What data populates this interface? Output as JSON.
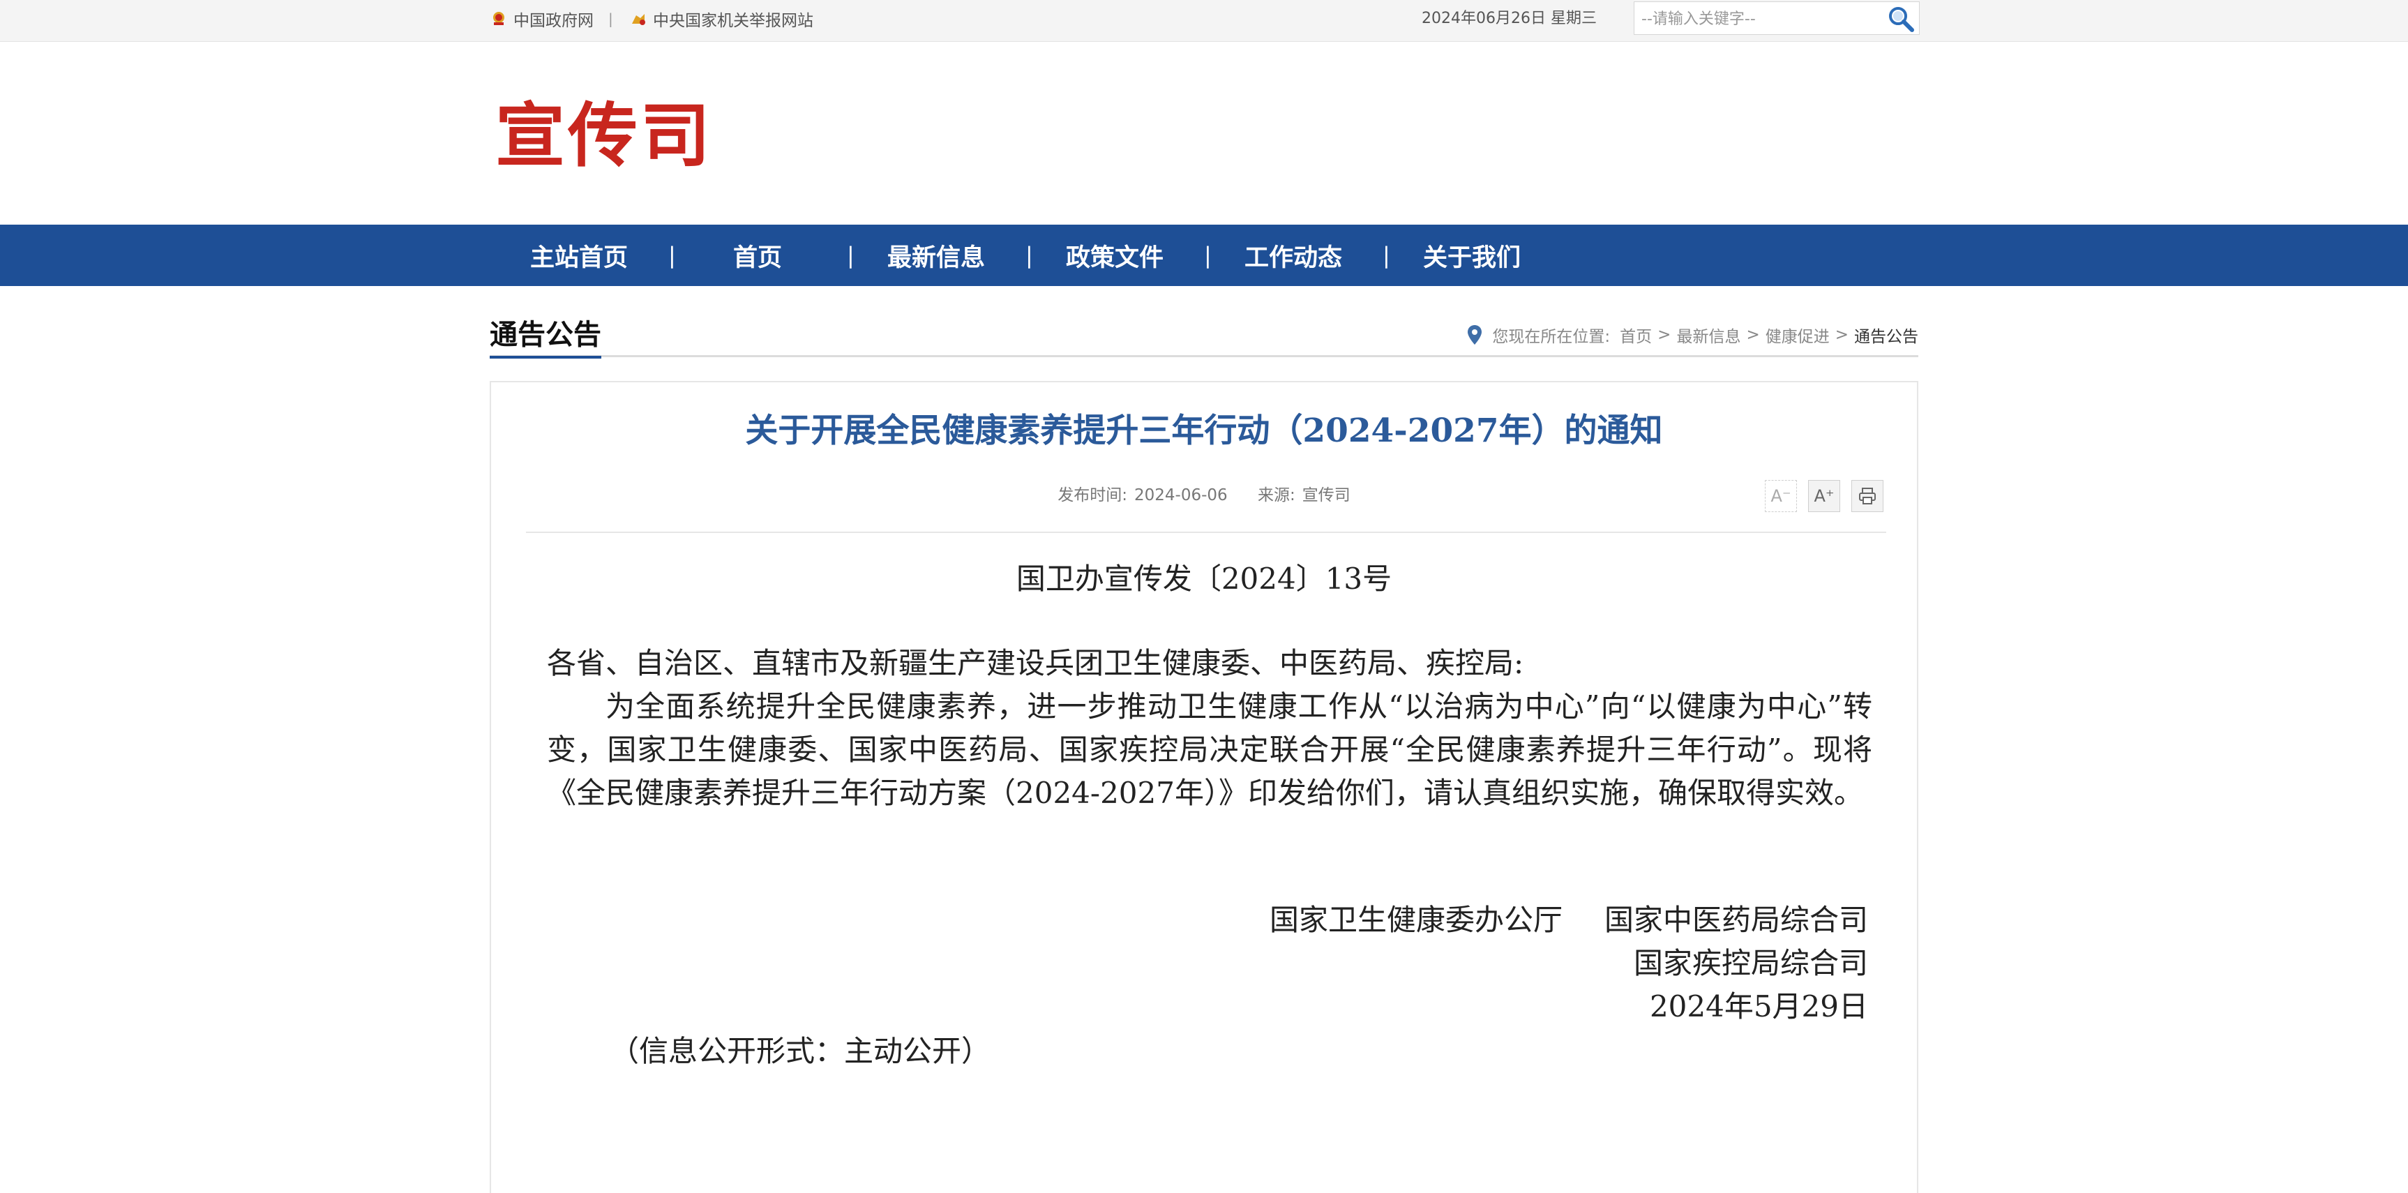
{
  "topbar": {
    "gov_link": "中国政府网",
    "separator": "|",
    "report_link": "中央国家机关举报网站",
    "date": "2024年06月26日 星期三",
    "search_placeholder": "--请输入关键字--"
  },
  "logo": "宣传司",
  "nav": {
    "items": [
      "主站首页",
      "首页",
      "最新信息",
      "政策文件",
      "工作动态",
      "关于我们"
    ],
    "separator": "|"
  },
  "section": {
    "title": "通告公告",
    "breadcrumb_label": "您现在所在位置:",
    "breadcrumb": [
      "首页",
      "最新信息",
      "健康促进",
      "通告公告"
    ],
    "breadcrumb_sep": ">"
  },
  "article": {
    "title": "关于开展全民健康素养提升三年行动（2024-2027年）的通知",
    "publish_label": "发布时间:",
    "publish_date": "2024-06-06",
    "source_label": "来源:",
    "source": "宣传司",
    "tools": {
      "font_smaller": "A⁻",
      "font_larger": "A⁺"
    },
    "doc_no": "国卫办宣传发〔2024〕13号",
    "salutation": "各省、自治区、直辖市及新疆生产建设兵团卫生健康委、中医药局、疾控局:",
    "paragraph": "为全面系统提升全民健康素养，进一步推动卫生健康工作从“以治病为中心”向“以健康为中心”转变，国家卫生健康委、国家中医药局、国家疾控局决定联合开展“全民健康素养提升三年行动”。现将《全民健康素养提升三年行动方案（2024-2027年）》印发给你们，请认真组织实施，确保取得实效。",
    "signer_1": "国家卫生健康委办公厅",
    "signer_2": "国家中医药局综合司",
    "signer_3": "国家疾控局综合司",
    "sign_date": "2024年5月29日",
    "disclosure": "（信息公开形式：主动公开）"
  },
  "colors": {
    "nav_bg": "#1e4f96",
    "logo_red": "#c8261e",
    "title_blue": "#2b5a9a"
  }
}
